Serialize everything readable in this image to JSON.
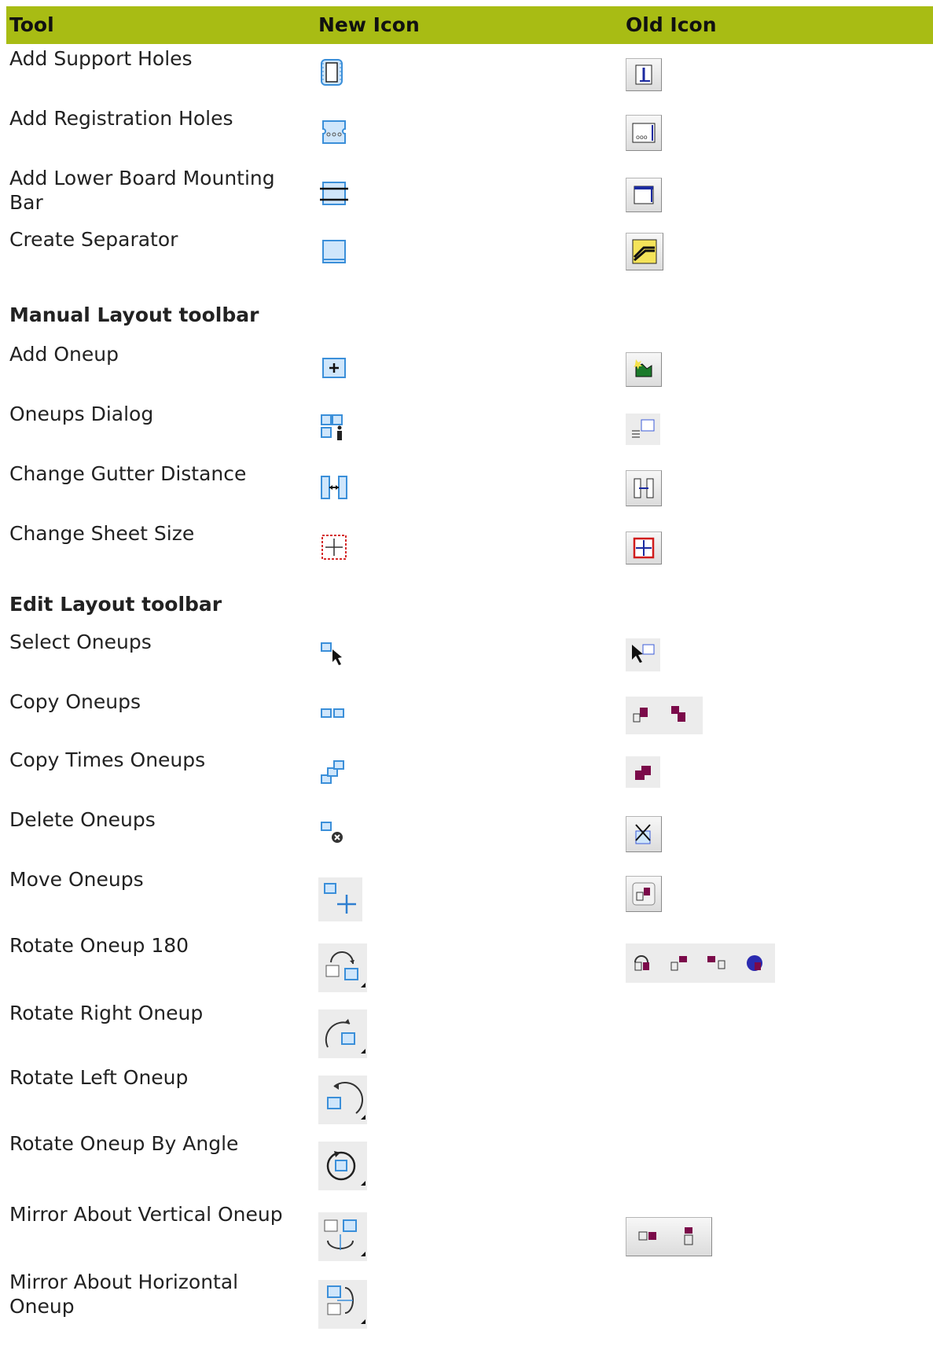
{
  "header": {
    "tool": "Tool",
    "new_icon": "New Icon",
    "old_icon": "Old Icon"
  },
  "colors": {
    "header_bg": "#a8bc14",
    "icon_blue": "#5aa7e6",
    "old_purple": "#7b0a4a"
  },
  "groups": [
    {
      "section": "",
      "rows": [
        {
          "name": "Add Support Holes",
          "new_icon": "support-holes-icon",
          "old_icon": "old-support-holes-icon"
        },
        {
          "name": "Add Registration Holes",
          "new_icon": "registration-holes-icon",
          "old_icon": "old-registration-holes-icon"
        },
        {
          "name": "Add Lower Board Mounting Bar",
          "new_icon": "mounting-bar-icon",
          "old_icon": "old-mounting-bar-icon"
        },
        {
          "name": "Create Separator",
          "new_icon": "separator-icon",
          "old_icon": "old-separator-icon"
        }
      ]
    },
    {
      "section": "Manual Layout toolbar",
      "rows": [
        {
          "name": "Add Oneup",
          "new_icon": "add-oneup-icon",
          "old_icon": "old-add-oneup-icon"
        },
        {
          "name": "Oneups Dialog",
          "new_icon": "oneups-dialog-icon",
          "old_icon": "old-oneups-dialog-icon"
        },
        {
          "name": "Change Gutter Distance",
          "new_icon": "gutter-distance-icon",
          "old_icon": "old-gutter-distance-icon"
        },
        {
          "name": "Change Sheet Size",
          "new_icon": "sheet-size-icon",
          "old_icon": "old-sheet-size-icon"
        }
      ]
    },
    {
      "section": "Edit Layout toolbar",
      "rows": [
        {
          "name": "Select Oneups",
          "new_icon": "select-oneups-icon",
          "old_icon": "old-select-oneups-icon"
        },
        {
          "name": "Copy Oneups",
          "new_icon": "copy-oneups-icon",
          "old_icon": "old-copy-oneups-icon"
        },
        {
          "name": "Copy Times Oneups",
          "new_icon": "copy-times-oneups-icon",
          "old_icon": "old-copy-times-oneups-icon"
        },
        {
          "name": "Delete Oneups",
          "new_icon": "delete-oneups-icon",
          "old_icon": "old-delete-oneups-icon"
        },
        {
          "name": "Move Oneups",
          "new_icon": "move-oneups-icon",
          "old_icon": "old-move-oneups-icon"
        },
        {
          "name": "Rotate Oneup 180",
          "new_icon": "rotate-180-icon",
          "old_icon": "old-rotate-icons"
        },
        {
          "name": "Rotate Right Oneup",
          "new_icon": "rotate-right-icon",
          "old_icon": ""
        },
        {
          "name": "Rotate Left Oneup",
          "new_icon": "rotate-left-icon",
          "old_icon": ""
        },
        {
          "name": "Rotate Oneup By Angle",
          "new_icon": "rotate-by-angle-icon",
          "old_icon": ""
        },
        {
          "name": "Mirror About Vertical Oneup",
          "new_icon": "mirror-vertical-icon",
          "old_icon": "old-mirror-icons"
        },
        {
          "name": "Mirror About Horizontal Oneup",
          "new_icon": "mirror-horizontal-icon",
          "old_icon": ""
        }
      ]
    }
  ]
}
